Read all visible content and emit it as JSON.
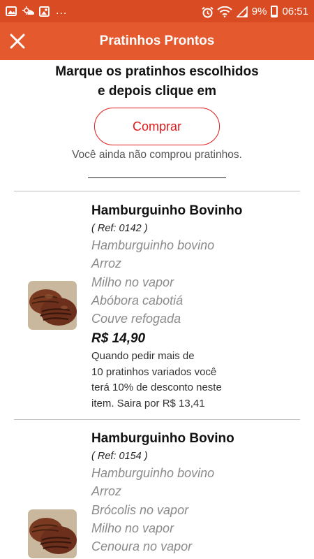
{
  "status_bar": {
    "left_dots": "...",
    "battery": "9%",
    "time": "06:51"
  },
  "app_bar": {
    "title": "Pratinhos Prontos",
    "close_icon": "close-icon"
  },
  "instruction": {
    "line1": "Marque os pratinhos escolhidos",
    "line2": "e depois clique em"
  },
  "buy_button": {
    "label": "Comprar"
  },
  "purchase_status": "Você ainda não comprou pratinhos.",
  "products": [
    {
      "name": "Hamburguinho Bovinho",
      "ref": "( Ref: 0142 )",
      "ingredients": [
        "Hamburguinho bovino",
        "Arroz",
        "Milho no vapor",
        "Abóbora cabotiá",
        "Couve refogada"
      ],
      "price": "R$ 14,90",
      "discount_lines": [
        "Quando pedir mais de",
        "10 pratinhos variados você",
        "terá 10% de desconto neste",
        "item. Saira por R$ 13,41"
      ]
    },
    {
      "name": "Hamburguinho Bovino",
      "ref": "( Ref: 0154 )",
      "ingredients": [
        "Hamburguinho bovino",
        "Arroz",
        "Brócolis no vapor",
        "Milho no vapor",
        "Cenoura no vapor"
      ]
    }
  ],
  "colors": {
    "status_bar": "#d94b22",
    "app_bar": "#e4592e",
    "buy_button": "#e01b1b"
  }
}
